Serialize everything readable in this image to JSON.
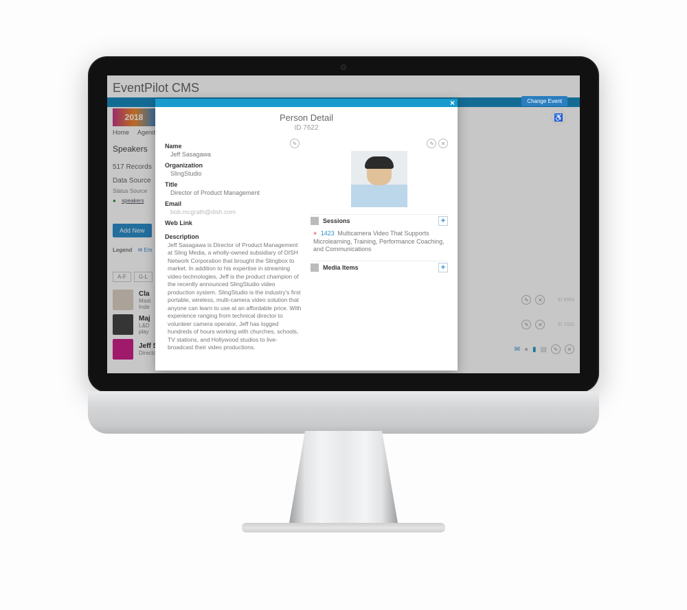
{
  "brand": "EventPilot CMS",
  "logo_year": "2018",
  "change_event": "Change Event",
  "nav": {
    "home": "Home",
    "agenda": "Agenda"
  },
  "page_title": "Speakers",
  "records": "517 Records",
  "data_source_label": "Data Source",
  "ds_cols": "Status   Source",
  "ds_link": "speakers",
  "add_new": "Add New",
  "legend": {
    "label": "Legend",
    "email": "Em"
  },
  "filters": {
    "af": "A-F",
    "gl": "G-L"
  },
  "rows": [
    {
      "name": "Cla",
      "sub1": "Mast",
      "sub2": "Inde",
      "id": "ID 6993"
    },
    {
      "name": "Maj",
      "sub1": "L&D",
      "sub2": "play",
      "id": "ID 7032"
    },
    {
      "name": "Jeff Sasagawa",
      "sub1": "Director of Product Management",
      "sub2": "",
      "id": ""
    }
  ],
  "row_preview": "Jeff Sasagawa is Director of Product Management at Sling Media, a wholly-",
  "modal": {
    "title": "Person Detail",
    "subtitle": "ID 7622",
    "name_label": "Name",
    "name": "Jeff Sasagawa",
    "org_label": "Organization",
    "org": "SlingStudio",
    "title_label": "Title",
    "title_val": "Director of Product Management",
    "email_label": "Email",
    "email": "bob.mcgrath@dish.com",
    "weblink_label": "Web Link",
    "desc_label": "Description",
    "desc": "Jeff Sasagawa is Director of Product Management at Sling Media, a wholly-owned subsidiary of DISH Network Corporation that brought the Slingbox to market. In addition to his expertise in streaming video technologies, Jeff is the product champion of the recently announced SlingStudio video production system. SlingStudio is the industry's first portable, wireless, multi-camera video solution that anyone can learn to use at an affordable price. With experience ranging from technical director to volunteer camera operator, Jeff has logged hundreds of hours working with churches, schools, TV stations, and Hollywood studios to live-broadcast their video productions.",
    "sessions_label": "Sessions",
    "session_id": "1423",
    "session_title": "Multicamera Video That Supports Microlearning, Training, Performance Coaching, and Communications",
    "media_label": "Media Items"
  }
}
